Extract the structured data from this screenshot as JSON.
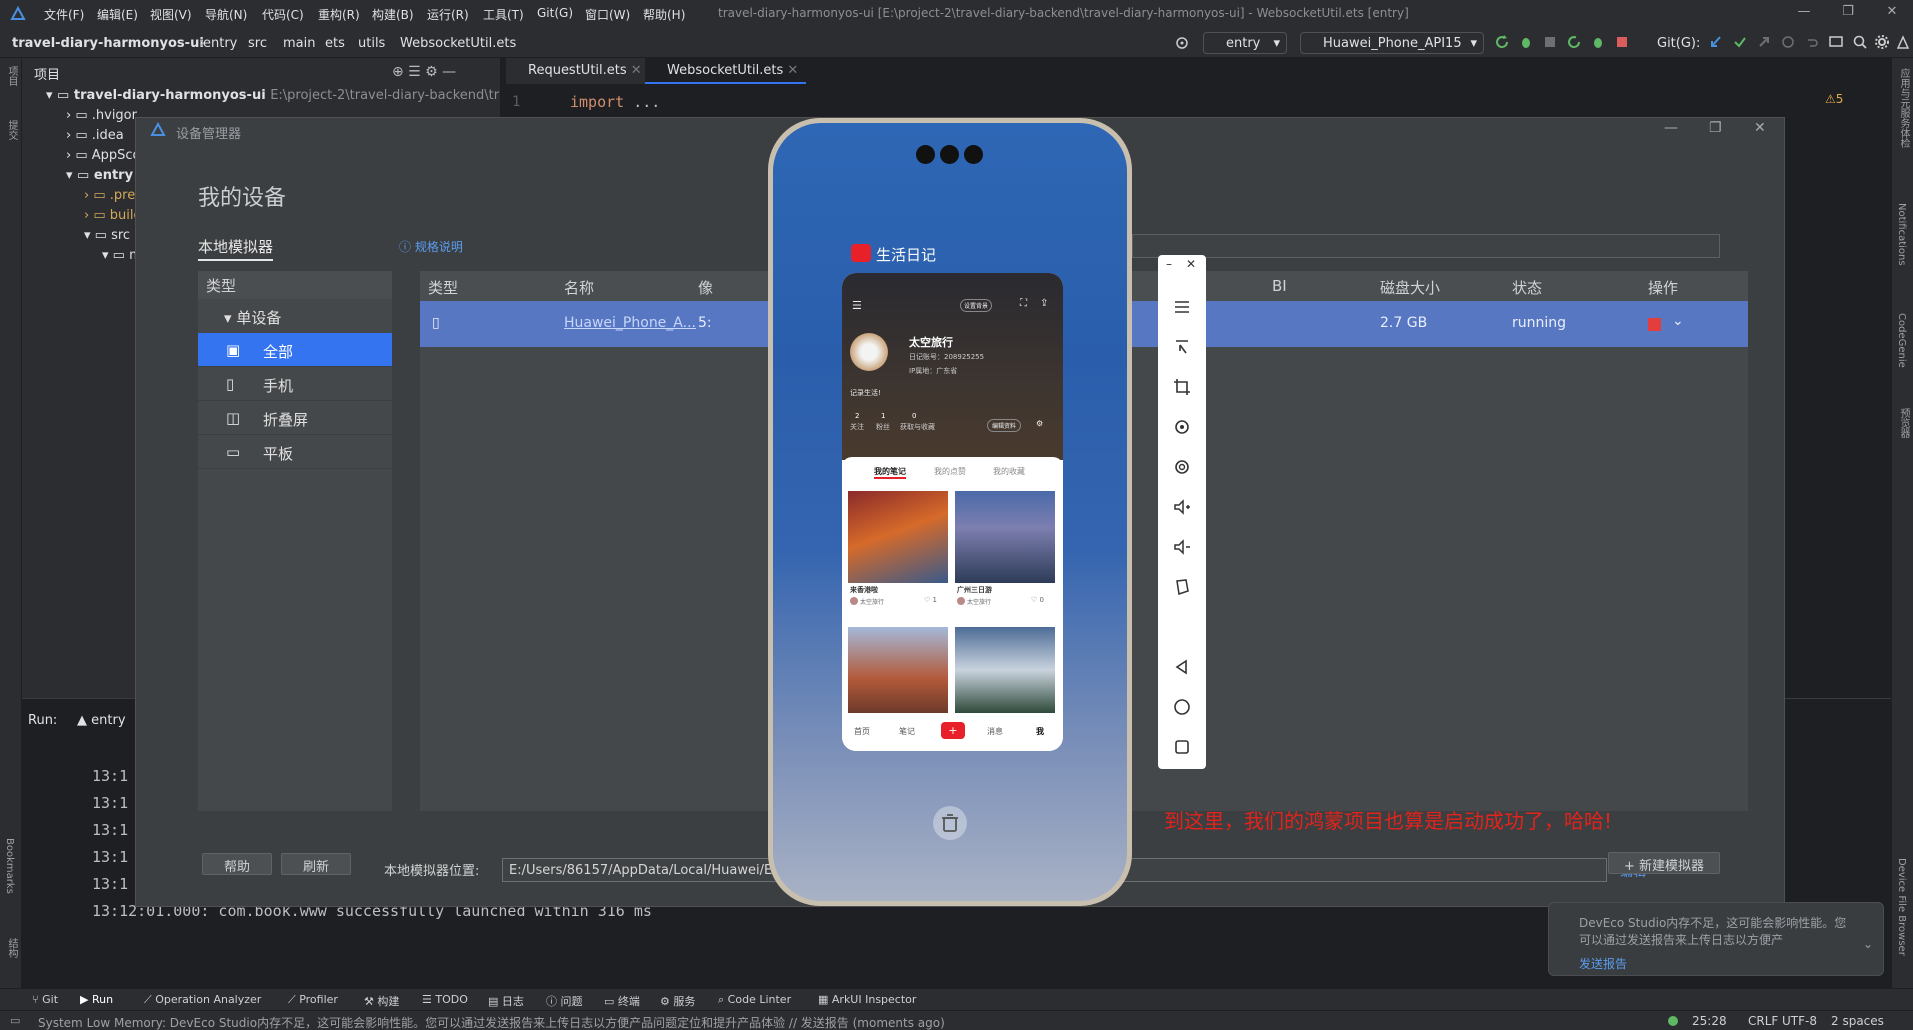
{
  "menubar": {
    "items": [
      "文件(F)",
      "编辑(E)",
      "视图(V)",
      "导航(N)",
      "代码(C)",
      "重构(R)",
      "构建(B)",
      "运行(R)",
      "工具(T)",
      "Git(G)",
      "窗口(W)",
      "帮助(H)"
    ],
    "window_title": "travel-diary-harmonyos-ui [E:\\project-2\\travel-diary-backend\\travel-diary-harmonyos-ui] - WebsocketUtil.ets [entry]"
  },
  "navbar": {
    "breadcrumb": [
      "travel-diary-harmonyos-ui",
      "entry",
      "src",
      "main",
      "ets",
      "utils",
      "WebsocketUtil.ets"
    ],
    "run_config": "entry",
    "device": "Huawei_Phone_API15",
    "git_label": "Git(G):"
  },
  "left_strip": {
    "project_label": "项目",
    "commit_label": "提交",
    "bookmarks_label": "Bookmarks",
    "structure_label": "结构"
  },
  "right_strip": {
    "label1": "应用与元服务体检",
    "label2": "Notifications",
    "label3": "CodeGenie",
    "label4": "预览器",
    "label5": "Device File Browser"
  },
  "project_panel": {
    "title": "项目",
    "root": "travel-diary-harmonyos-ui",
    "root_path": "E:\\project-2\\travel-diary-backend\\travel-",
    "items": [
      ".hvigor",
      ".idea",
      "AppScop",
      "entry",
      ".previ",
      "build",
      "src",
      "ma"
    ]
  },
  "editor": {
    "tabs": [
      {
        "label": "RequestUtil.ets"
      },
      {
        "label": "WebsocketUtil.ets"
      }
    ],
    "line_no": "1",
    "code_keyword": "import",
    "code_rest": " ...",
    "warnings": "5"
  },
  "run_panel": {
    "title": "Run:",
    "config": "entry",
    "log": [
      "13:1",
      "13:1",
      "13:1",
      "13:1",
      "13:1",
      "13:12:01.000: com.book.www successfully launched within 316 ms"
    ]
  },
  "device_manager": {
    "window_title": "设备管理器",
    "heading": "我的设备",
    "tab": "本地模拟器",
    "spec_link": "规格说明",
    "type_header": "类型",
    "group": "单设备",
    "types": [
      {
        "label": "全部"
      },
      {
        "label": "手机"
      },
      {
        "label": "折叠屏"
      },
      {
        "label": "平板"
      }
    ],
    "columns": {
      "type": "类型",
      "name": "名称",
      "api": "像",
      "bi": "BI",
      "disk": "磁盘大小",
      "status": "状态",
      "action": "操作"
    },
    "device_row": {
      "name": "Huawei_Phone_A...",
      "api": "5:",
      "disk": "2.7 GB",
      "status": "running"
    },
    "help_button": "帮助",
    "refresh_button": "刷新",
    "location_label": "本地模拟器位置:",
    "location_value": "E:/Users/86157/AppData/Local/Huawei/Emulator/deployed",
    "edit_link": "编辑",
    "new_button": "新建模拟器"
  },
  "phone": {
    "app_name": "生活日记",
    "username": "太空旅行",
    "account": "日记账号：208925255",
    "location": "IP属地：广东省",
    "bio": "记录生活!",
    "stats": [
      {
        "num": "2",
        "label": "关注"
      },
      {
        "num": "1",
        "label": "粉丝"
      },
      {
        "num": "0",
        "label": "获取与收藏"
      }
    ],
    "edit_profile": "编辑资料",
    "set_bg": "设置背景",
    "tabs": [
      "我的笔记",
      "我的点赞",
      "我的收藏"
    ],
    "notes": [
      {
        "title": "来香港啦",
        "author": "太空旅行",
        "likes": "1"
      },
      {
        "title": "广州三日游",
        "author": "太空旅行",
        "likes": "0"
      }
    ],
    "nav": [
      "首页",
      "笔记",
      "+",
      "消息",
      "我"
    ]
  },
  "overlay_message": "到这里，我们的鸿蒙项目也算是启动成功了，哈哈!",
  "toast": {
    "text": "DevEco Studio内存不足，这可能会影响性能。您可以通过发送报告来上传日志以方便产",
    "link": "发送报告"
  },
  "bottom_tools": [
    "Git",
    "Run",
    "Operation Analyzer",
    "Profiler",
    "构建",
    "TODO",
    "日志",
    "问题",
    "终端",
    "服务",
    "Code Linter",
    "ArkUI Inspector"
  ],
  "status": {
    "message": "System Low Memory: DevEco Studio内存不足，这可能会影响性能。您可以通过发送报告来上传日志以方便产品问题定位和提升产品体验 // 发送报告 (moments ago)",
    "position": "25:28",
    "line_ending": "CRLF",
    "encoding": "UTF-8",
    "indent": "2 spaces"
  },
  "colors": {
    "accent": "#3574f0",
    "selected_row": "#5877c3",
    "red_text": "#e3231b",
    "brand_red": "#e8202a"
  }
}
